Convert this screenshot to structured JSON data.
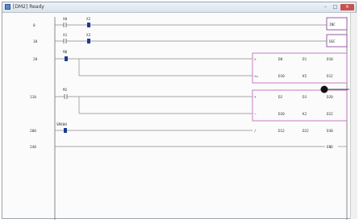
{
  "window": {
    "title": "[DM2] Ready",
    "controls": {
      "minimize": "–",
      "maximize": "□",
      "close": "×"
    }
  },
  "rungs": [
    "0",
    "10",
    "20",
    "110",
    "200",
    "240"
  ],
  "contacts": {
    "x0": "X0",
    "x2": "X2",
    "x1": "X1",
    "x3": "X3",
    "m0": "M0",
    "m1": "M1",
    "sm400": "SM400"
  },
  "coils": {
    "inc": "INC",
    "dec": "DEC",
    "end": "END"
  },
  "instructions": [
    {
      "op": ">",
      "a": "D0",
      "b": "D1",
      "c": "D10"
    },
    {
      "op": "<=",
      "a": "D10",
      "b": "K5",
      "c": "D12"
    },
    {
      "op": "+",
      "a": "D2",
      "b": "D3",
      "c": "D20"
    },
    {
      "op": "−",
      "a": "D20",
      "b": "K2",
      "c": "D22"
    },
    {
      "op": "/",
      "a": "D12",
      "b": "D22",
      "c": "D30"
    }
  ],
  "colors": {
    "rail": "#6e6e6e",
    "selection": "#c070c0",
    "contact_selected": "#1a3d8f"
  }
}
